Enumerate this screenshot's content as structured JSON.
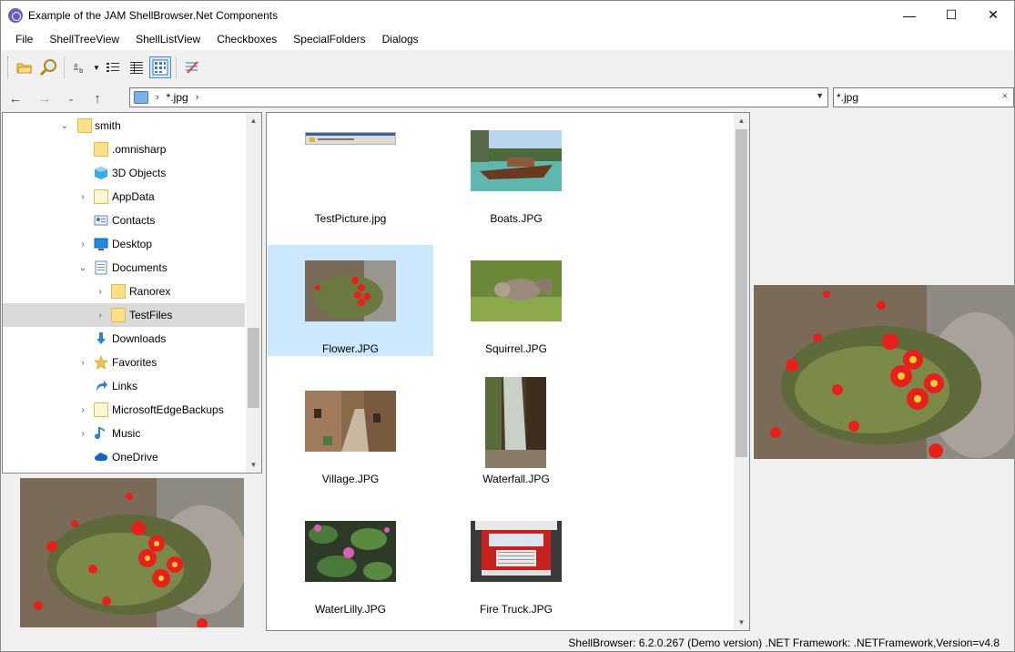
{
  "window": {
    "title": "Example of the JAM ShellBrowser.Net Components",
    "minimize": "—",
    "maximize": "☐",
    "close": "✕"
  },
  "menu": [
    "File",
    "ShellTreeView",
    "ShellListView",
    "Checkboxes",
    "SpecialFolders",
    "Dialogs"
  ],
  "nav": {
    "back": "←",
    "forward": "→",
    "recent": "⌄",
    "up": "↑",
    "address_path": "*.jpg",
    "address_sep": "›",
    "filter_value": "*.jpg",
    "filter_clear": "×"
  },
  "tree": {
    "items": [
      {
        "label": "smith",
        "icon": "folder-icon",
        "expanded": true
      },
      {
        "label": ".omnisharp",
        "icon": "folder-icon"
      },
      {
        "label": "3D Objects",
        "icon": "cube-icon"
      },
      {
        "label": "AppData",
        "icon": "folder-icon"
      },
      {
        "label": "Contacts",
        "icon": "contacts-icon"
      },
      {
        "label": "Desktop",
        "icon": "desktop-icon"
      },
      {
        "label": "Documents",
        "icon": "documents-icon",
        "expanded": true
      },
      {
        "label": "Ranorex",
        "icon": "folder-icon"
      },
      {
        "label": "TestFiles",
        "icon": "folder-icon",
        "selected": true
      },
      {
        "label": "Downloads",
        "icon": "downloads-icon"
      },
      {
        "label": "Favorites",
        "icon": "star-icon"
      },
      {
        "label": "Links",
        "icon": "links-icon"
      },
      {
        "label": "MicrosoftEdgeBackups",
        "icon": "folder-icon"
      },
      {
        "label": "Music",
        "icon": "music-icon"
      },
      {
        "label": "OneDrive",
        "icon": "cloud-icon"
      }
    ]
  },
  "files": [
    {
      "label": "TestPicture.jpg"
    },
    {
      "label": "Boats.JPG"
    },
    {
      "label": "Flower.JPG",
      "selected": true
    },
    {
      "label": "Squirrel.JPG"
    },
    {
      "label": "Village.JPG"
    },
    {
      "label": "Waterfall.JPG"
    },
    {
      "label": "WaterLilly.JPG"
    },
    {
      "label": "Fire Truck.JPG"
    }
  ],
  "status": "ShellBrowser: 6.2.0.267 (Demo version) .NET Framework: .NETFramework,Version=v4.8",
  "colors": {
    "selection": "#cce8ff",
    "tree_selection": "#d9d9d9",
    "folder": "#ffe08a"
  }
}
